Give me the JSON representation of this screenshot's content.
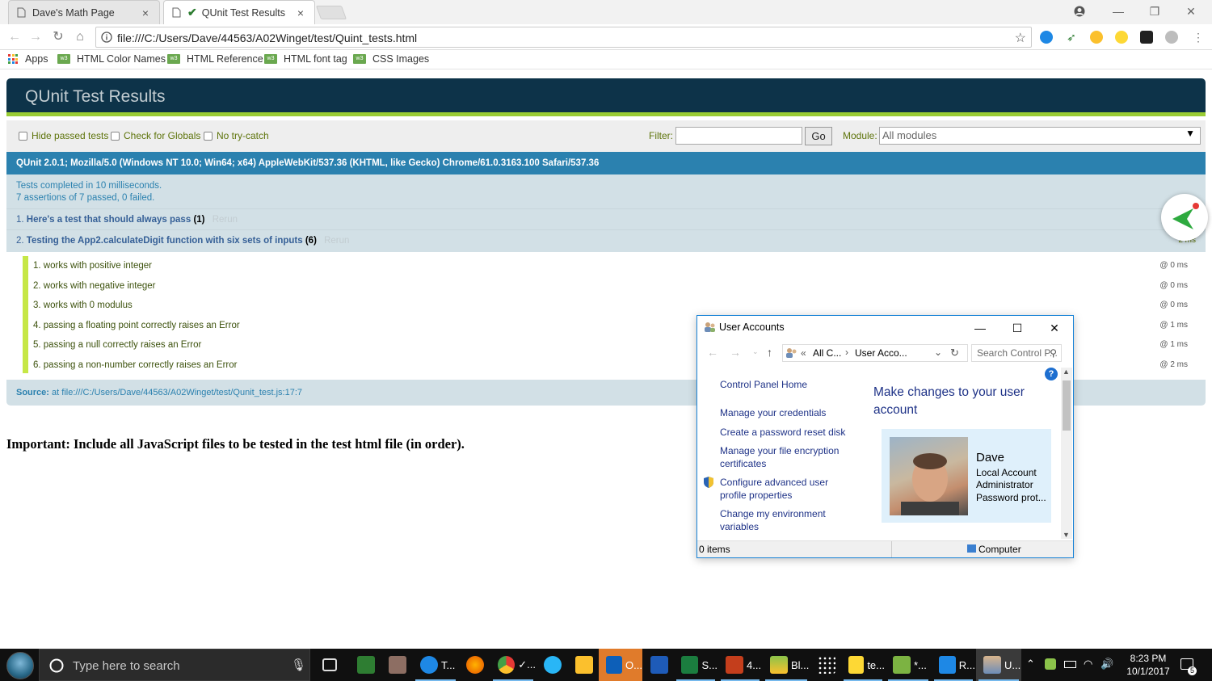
{
  "browser": {
    "tabs": [
      {
        "title": "Dave's Math Page"
      },
      {
        "title": "QUnit Test Results"
      }
    ],
    "url": "file:///C:/Users/Dave/44563/A02Winget/test/Quint_tests.html",
    "bookmarks": [
      "Apps",
      "HTML Color Names",
      "HTML Reference",
      "HTML font tag",
      "CSS Images"
    ]
  },
  "qunit": {
    "header": "QUnit Test Results",
    "toolbar": {
      "hide_passed": "Hide passed tests",
      "check_globals": "Check for Globals",
      "no_try_catch": "No try-catch",
      "filter_label": "Filter:",
      "go_label": "Go",
      "module_label": "Module:",
      "module_value": "All modules"
    },
    "user_agent": "QUnit 2.0.1; Mozilla/5.0 (Windows NT 10.0; Win64; x64) AppleWebKit/537.36 (KHTML, like Gecko) Chrome/61.0.3163.100 Safari/537.36",
    "result_line1": "Tests completed in 10 milliseconds.",
    "result_line2": "7 assertions of 7 passed, 0 failed.",
    "tests": [
      {
        "num": "1.",
        "name": "Here's a test that should always pass",
        "count": "(1)",
        "rerun": "Rerun"
      },
      {
        "num": "2.",
        "name": "Testing the App2.calculateDigit function with six sets of inputs",
        "count": "(6)",
        "rerun": "Rerun",
        "time": "2 ms"
      }
    ],
    "assertions": [
      {
        "text": "1. works with positive integer",
        "time": "@ 0 ms"
      },
      {
        "text": "2. works with negative integer",
        "time": "@ 0 ms"
      },
      {
        "text": "3. works with 0 modulus",
        "time": "@ 0 ms"
      },
      {
        "text": "4. passing a floating point correctly raises an Error",
        "time": "@ 1 ms"
      },
      {
        "text": "5. passing a null correctly raises an Error",
        "time": "@ 1 ms"
      },
      {
        "text": "6. passing a non-number correctly raises an Error",
        "time": "@ 2 ms"
      }
    ],
    "source_label": "Source:",
    "source_value": "at file:///C:/Users/Dave/44563/A02Winget/test/Qunit_test.js:17:7"
  },
  "important_note": "Important: Include all JavaScript files to be tested in the test html file (in order).",
  "user_accounts": {
    "title": "User Accounts",
    "breadcrumb_prefix": "«",
    "breadcrumb_1": "All C...",
    "breadcrumb_sep": "›",
    "breadcrumb_2": "User Acco...",
    "search_placeholder": "Search Control P...",
    "links": [
      "Control Panel Home",
      "Manage your credentials",
      "Create a password reset disk",
      "Manage your file encryption certificates",
      "Configure advanced user profile properties",
      "Change my environment variables"
    ],
    "heading": "Make changes to your user account",
    "user_name": "Dave",
    "user_details": [
      "Local Account",
      "Administrator",
      "Password prot..."
    ],
    "status_items": "0 items",
    "status_location": "Computer",
    "help_glyph": "?"
  },
  "taskbar": {
    "search_placeholder": "Type here to search",
    "apps": [
      "T...",
      "✓...",
      "O...",
      "S...",
      "4...",
      "Bl...",
      "te...",
      "*...",
      "R...",
      "U..."
    ],
    "time": "8:23 PM",
    "date": "10/1/2017",
    "notification_count": "5"
  }
}
